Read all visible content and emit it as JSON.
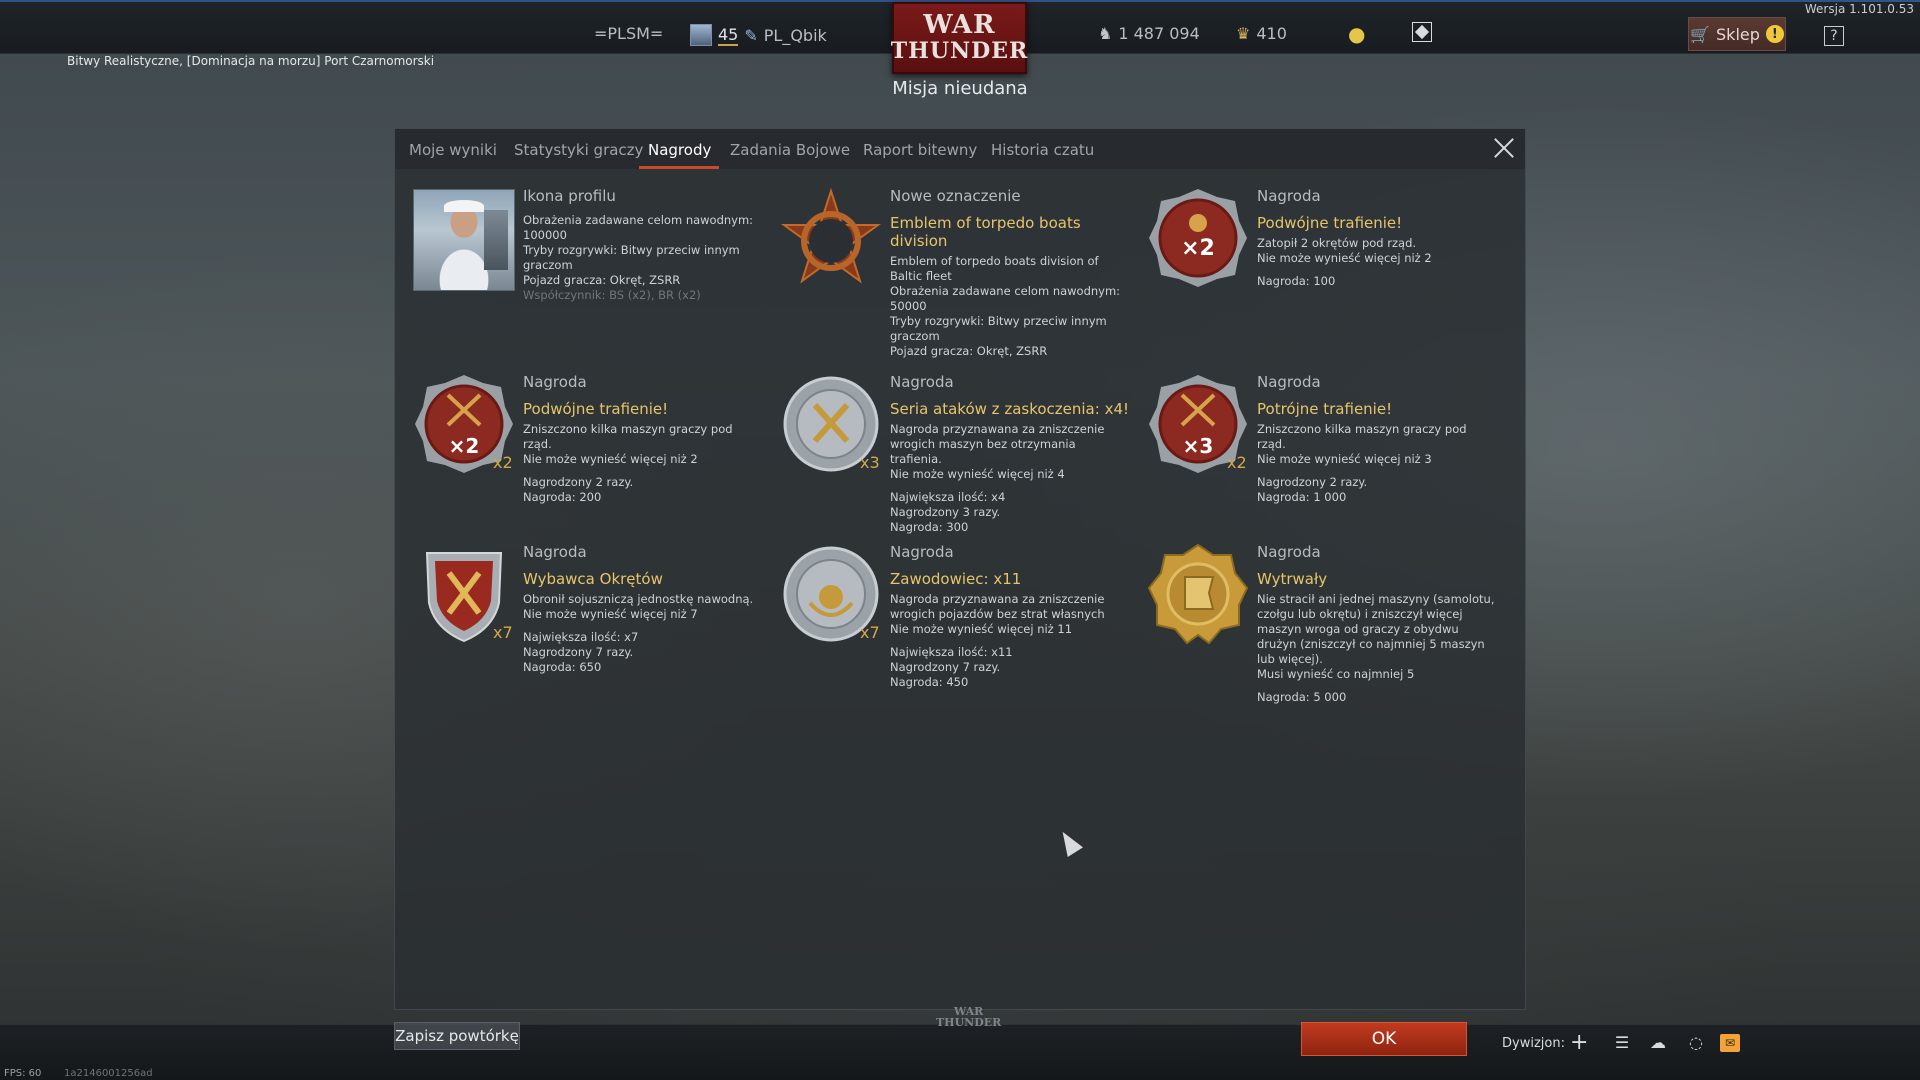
{
  "header": {
    "version": "Wersja 1.101.0.53",
    "squad_tag": "=PLSM=",
    "player_level": "45",
    "player_name": "PL_Qbik",
    "logo_line1": "WAR",
    "logo_line2": "THUNDER",
    "silver_lions": "1 487 094",
    "golden_eagles": "410",
    "shop_label": "Sklep",
    "shop_alert": "!",
    "help_label": "?"
  },
  "battle_info": "Bitwy Realistyczne, [Dominacja na morzu] Port Czarnomorski",
  "mission_status": "Misja nieudana",
  "tabs": [
    {
      "label": "Moje wyniki"
    },
    {
      "label": "Statystyki graczy"
    },
    {
      "label": "Nagrody"
    },
    {
      "label": "Zadania Bojowe"
    },
    {
      "label": "Raport bitewny"
    },
    {
      "label": "Historia czatu"
    }
  ],
  "active_tab": "Nagrody",
  "rewards": [
    {
      "label": "Ikona profilu",
      "title": "",
      "lines": [
        "Obrażenia zadawane celom nawodnym: 100000",
        "Tryby rozgrywki: Bitwy przeciw innym graczom",
        "Pojazd gracza: Okręt, ZSRR"
      ],
      "muted": "Współczynnik: BS (x2), BR (x2)",
      "icon": "profile-photo-icon"
    },
    {
      "label": "Nowe oznaczenie",
      "title": "Emblem of torpedo boats division",
      "lines": [
        "Emblem of torpedo boats division of Baltic fleet",
        "Obrażenia zadawane celom nawodnym: 50000",
        "Tryby rozgrywki: Bitwy przeciw innym graczom",
        "Pojazd gracza: Okręt, ZSRR"
      ],
      "icon": "star-emblem-icon"
    },
    {
      "label": "Nagroda",
      "title": "Podwójne trafienie!",
      "lines": [
        "Zatopił 2 okrętów pod rząd.",
        "Nie może wynieść więcej niż 2"
      ],
      "extra": [
        "Nagroda: 100"
      ],
      "icon": "double-hit-medal-icon",
      "multiplier": ""
    },
    {
      "label": "Nagroda",
      "title": "Podwójne trafienie!",
      "lines": [
        "Zniszczono kilka maszyn graczy pod rząd.",
        "Nie może wynieść więcej niż 2"
      ],
      "extra": [
        "Nagrodzony 2 razy.",
        "Nagroda: 200"
      ],
      "icon": "double-hit-medal-icon",
      "multiplier": "x2"
    },
    {
      "label": "Nagroda",
      "title": "Seria ataków z zaskoczenia: x4!",
      "lines": [
        "Nagroda przyznawana za zniszczenie wrogich maszyn bez otrzymania trafienia.",
        "Nie może wynieść więcej niż 4"
      ],
      "extra": [
        "Największa ilość: x4",
        "Nagrodzony 3 razy.",
        "Nagroda: 300"
      ],
      "icon": "surprise-attack-medal-icon",
      "multiplier": "x3"
    },
    {
      "label": "Nagroda",
      "title": "Potrójne trafienie!",
      "lines": [
        "Zniszczono kilka maszyn graczy pod rząd.",
        "Nie może wynieść więcej niż 3"
      ],
      "extra": [
        "Nagrodzony 2 razy.",
        "Nagroda: 1 000"
      ],
      "icon": "triple-hit-medal-icon",
      "multiplier": "x2"
    },
    {
      "label": "Nagroda",
      "title": "Wybawca Okrętów",
      "lines": [
        "Obronił sojuszniczą jednostkę nawodną.",
        "Nie może wynieść więcej niż 7"
      ],
      "extra": [
        "Największa ilość: x7",
        "Nagrodzony 7 razy.",
        "Nagroda: 650"
      ],
      "icon": "ship-savior-shield-icon",
      "multiplier": "x7"
    },
    {
      "label": "Nagroda",
      "title": "Zawodowiec: x11",
      "lines": [
        "Nagroda przyznawana za zniszczenie wrogich pojazdów bez strat własnych",
        "Nie może wynieść więcej niż 11"
      ],
      "extra": [
        "Największa ilość: x11",
        "Nagrodzony 7 razy.",
        "Nagroda: 450"
      ],
      "icon": "professional-medal-icon",
      "multiplier": "x7"
    },
    {
      "label": "Nagroda",
      "title": "Wytrwały",
      "lines": [
        "Nie stracił ani jednej maszyny (samolotu, czołgu lub okrętu) i zniszczył więcej maszyn wroga od graczy z obydwu drużyn (zniszczył co najmniej 5 maszyn lub więcej).",
        "Musi wynieść co najmniej 5"
      ],
      "extra": [
        "Nagroda: 5 000"
      ],
      "icon": "persistent-flag-medal-icon",
      "multiplier": ""
    }
  ],
  "footer": {
    "replay_label": "Zapisz powtórkę",
    "small_logo_1": "WAR",
    "small_logo_2": "THUNDER",
    "ok_label": "OK",
    "squad_label": "Dywizjon:",
    "fps": "FPS: 60",
    "hash": "1a2146001256ad"
  },
  "colors": {
    "accent_red": "#cc4a2a",
    "reward_title": "#e6c56a",
    "multiplier": "#d5a84a"
  }
}
